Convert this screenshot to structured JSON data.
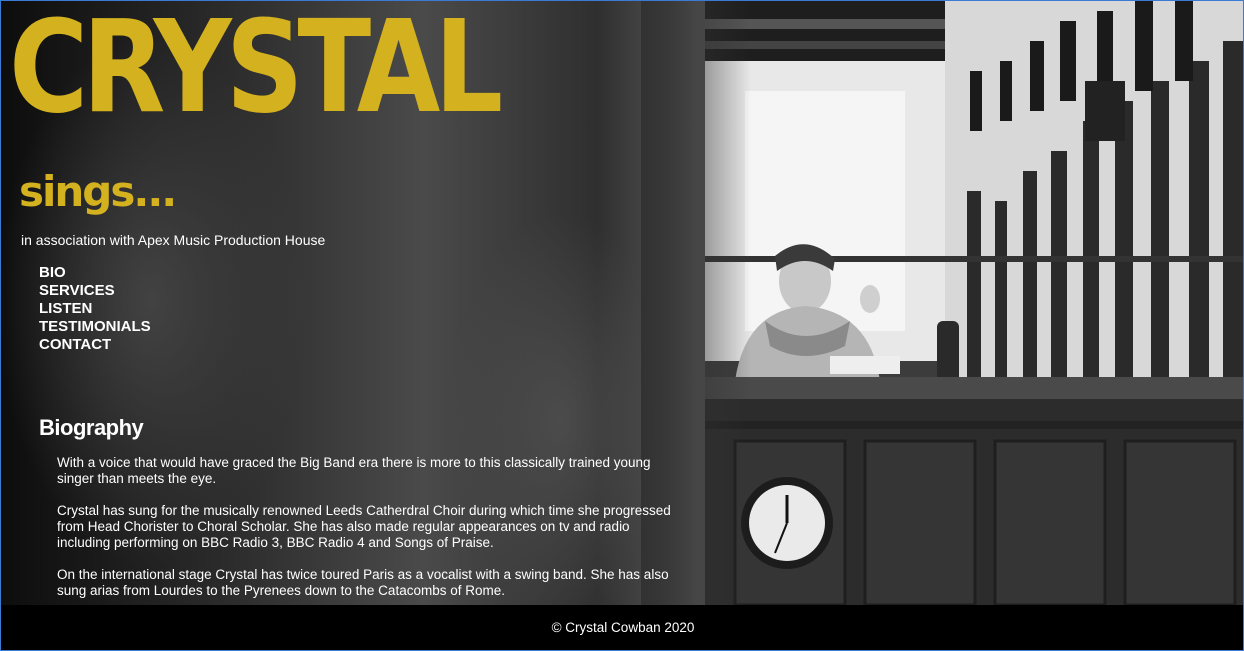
{
  "header": {
    "title": "CRYSTAL",
    "subtitle": "sings...",
    "association": "in association with Apex Music Production House"
  },
  "nav": {
    "items": [
      {
        "label": "BIO"
      },
      {
        "label": "SERVICES"
      },
      {
        "label": "LISTEN"
      },
      {
        "label": "TESTIMONIALS"
      },
      {
        "label": "CONTACT"
      }
    ]
  },
  "bio": {
    "heading": "Biography",
    "paragraphs": [
      "With a voice that would have graced the Big Band era there is more to this classically trained young singer than meets the eye.",
      "Crystal has sung for the musically renowned Leeds Catherdral Choir during which time she progressed from Head Chorister to Choral Scholar. She has also made regular appearances on tv and radio including performing on BBC Radio 3, BBC Radio 4 and Songs of Praise.",
      "On the international stage Crystal has twice toured Paris as a vocalist with a swing band. She has also sung arias from Lourdes to the Pyrenees down to the Catacombs of Rome."
    ]
  },
  "footer": {
    "copyright": "© Crystal Cowban 2020"
  },
  "colors": {
    "accent": "#d4b11f",
    "footer_bg": "#000000"
  }
}
